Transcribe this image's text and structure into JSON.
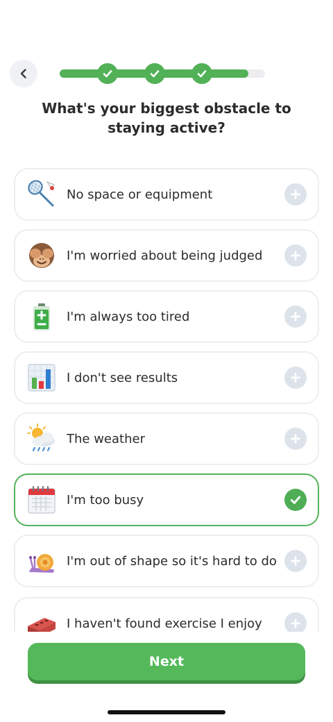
{
  "header": {
    "back_icon": "chevron-left-icon",
    "progress": {
      "value": 0.92,
      "completed_steps": 3
    }
  },
  "question": {
    "title": "What's your biggest obstacle to staying active?"
  },
  "options": [
    {
      "label": "No space or equipment",
      "icon": "badminton-icon",
      "selected": false
    },
    {
      "label": "I'm worried about being judged",
      "icon": "see-no-evil-monkey-icon",
      "selected": false
    },
    {
      "label": "I'm always too tired",
      "icon": "low-battery-icon",
      "selected": false
    },
    {
      "label": "I don't see results",
      "icon": "bar-chart-icon",
      "selected": false
    },
    {
      "label": "The weather",
      "icon": "sun-behind-rain-cloud-icon",
      "selected": false
    },
    {
      "label": "I'm too busy",
      "icon": "calendar-icon",
      "selected": true
    },
    {
      "label": "I'm out of shape so it's hard to do",
      "icon": "snail-icon",
      "selected": false
    },
    {
      "label": "I haven't found exercise I enjoy",
      "icon": "brick-icon",
      "selected": false
    }
  ],
  "footer": {
    "next_label": "Next"
  },
  "colors": {
    "accent": "#52b157",
    "unselected_state": "#dde3ea"
  }
}
